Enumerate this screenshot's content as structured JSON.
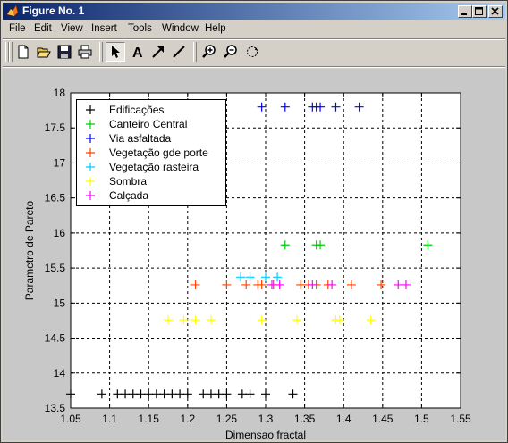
{
  "window": {
    "title": "Figure No. 1",
    "minimize_icon": "minimize-icon",
    "maximize_icon": "maximize-icon",
    "close_icon": "close-icon"
  },
  "menu": {
    "items": [
      "File",
      "Edit",
      "View",
      "Insert",
      "Tools",
      "Window",
      "Help"
    ]
  },
  "toolbar": {
    "buttons": [
      "new-figure-icon",
      "open-file-icon",
      "save-icon",
      "print-icon",
      "select-arrow-icon",
      "insert-text-icon",
      "insert-arrow-icon",
      "insert-line-icon",
      "zoom-in-icon",
      "zoom-out-icon",
      "rotate-3d-icon"
    ],
    "selected": "select-arrow-icon"
  },
  "chart_data": {
    "type": "scatter",
    "title": "",
    "xlabel": "Dimensao fractal",
    "ylabel": "Parametro de Pareto",
    "xlim": [
      1.05,
      1.55
    ],
    "ylim": [
      13.5,
      18
    ],
    "xticks": [
      "1.05",
      "1.1",
      "1.15",
      "1.2",
      "1.25",
      "1.3",
      "1.35",
      "1.4",
      "1.45",
      "1.5",
      "1.55"
    ],
    "yticks": [
      "13.5",
      "14",
      "14.5",
      "15",
      "15.5",
      "16",
      "16.5",
      "17",
      "17.5",
      "18"
    ],
    "grid": true,
    "legend_position": "top-left",
    "marker": "+",
    "series": [
      {
        "name": "Edificações",
        "color": "#000000",
        "x": [
          1.05,
          1.09,
          1.11,
          1.12,
          1.13,
          1.14,
          1.15,
          1.16,
          1.17,
          1.18,
          1.19,
          1.2,
          1.22,
          1.23,
          1.24,
          1.25,
          1.27,
          1.28,
          1.3,
          1.335
        ],
        "y": [
          13.7,
          13.7,
          13.7,
          13.7,
          13.7,
          13.7,
          13.7,
          13.7,
          13.7,
          13.7,
          13.7,
          13.7,
          13.7,
          13.7,
          13.7,
          13.7,
          13.7,
          13.7,
          13.7,
          13.7
        ]
      },
      {
        "name": "Canteiro Central",
        "color": "#00cc00",
        "x": [
          1.325,
          1.365,
          1.37,
          1.508
        ],
        "y": [
          15.83,
          15.83,
          15.83,
          15.83
        ]
      },
      {
        "name": "Via asfaltada",
        "color": "#0000ff",
        "x": [
          1.295,
          1.325,
          1.36,
          1.365,
          1.37,
          1.39,
          1.42
        ],
        "y": [
          17.8,
          17.8,
          17.8,
          17.8,
          17.8,
          17.8,
          17.8
        ]
      },
      {
        "name": "Vegetação gde porte",
        "color": "#ff4400",
        "x": [
          1.21,
          1.25,
          1.275,
          1.29,
          1.295,
          1.31,
          1.345,
          1.355,
          1.365,
          1.38,
          1.41,
          1.448
        ],
        "y": [
          15.26,
          15.26,
          15.26,
          15.26,
          15.26,
          15.26,
          15.26,
          15.26,
          15.26,
          15.26,
          15.26,
          15.26
        ]
      },
      {
        "name": "Vegetação rasteira",
        "color": "#00ccff",
        "x": [
          1.268,
          1.28,
          1.3,
          1.315
        ],
        "y": [
          15.37,
          15.37,
          15.37,
          15.37
        ]
      },
      {
        "name": "Sombra",
        "color": "#ffff00",
        "x": [
          1.175,
          1.195,
          1.21,
          1.23,
          1.295,
          1.34,
          1.39,
          1.395,
          1.435
        ],
        "y": [
          14.76,
          14.76,
          14.76,
          14.76,
          14.76,
          14.76,
          14.76,
          14.76,
          14.76
        ]
      },
      {
        "name": "Calçada",
        "color": "#ff00ff",
        "x": [
          1.308,
          1.318,
          1.36,
          1.385,
          1.47,
          1.48
        ],
        "y": [
          15.26,
          15.26,
          15.26,
          15.26,
          15.26,
          15.26
        ]
      }
    ]
  }
}
